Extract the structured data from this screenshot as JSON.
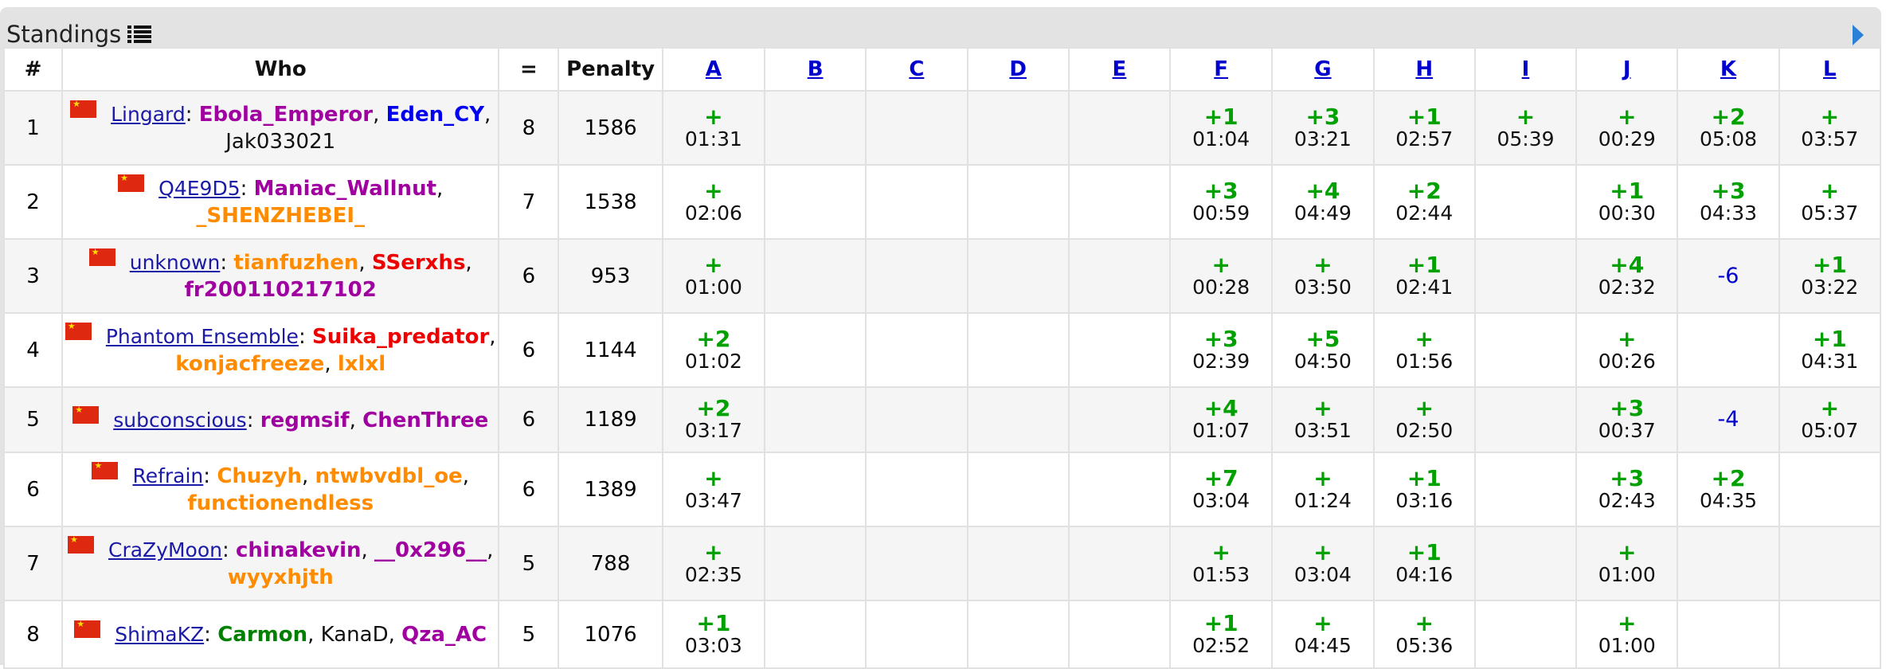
{
  "header": {
    "title": "Standings",
    "list_icon": "list-icon",
    "next_icon": "play-arrow-icon"
  },
  "colors": {
    "accepted": "#00a000",
    "rejected": "#0000cc",
    "team_link": "#1a1aa6",
    "panel": "#e3e3e3",
    "flag": "#de2910"
  },
  "columns": {
    "rank": "#",
    "who": "Who",
    "solved": "=",
    "penalty": "Penalty"
  },
  "problems": [
    "A",
    "B",
    "C",
    "D",
    "E",
    "F",
    "G",
    "H",
    "I",
    "J",
    "K",
    "L"
  ],
  "rows": [
    {
      "rank": "1",
      "team": "Lingard",
      "members": [
        {
          "name": "Ebola_Emperor",
          "color": "purple"
        },
        {
          "name": "Eden_CY",
          "color": "blue"
        },
        {
          "name": "Jak033021",
          "color": "gray"
        }
      ],
      "solved": "8",
      "penalty": "1586",
      "cells": [
        {
          "r": "+",
          "t": "01:31"
        },
        null,
        null,
        null,
        null,
        {
          "r": "+1",
          "t": "01:04"
        },
        {
          "r": "+3",
          "t": "03:21"
        },
        {
          "r": "+1",
          "t": "02:57"
        },
        {
          "r": "+",
          "t": "05:39"
        },
        {
          "r": "+",
          "t": "00:29"
        },
        {
          "r": "+2",
          "t": "05:08"
        },
        {
          "r": "+",
          "t": "03:57"
        }
      ]
    },
    {
      "rank": "2",
      "team": "Q4E9D5",
      "members": [
        {
          "name": "Maniac_Wallnut",
          "color": "purple"
        },
        {
          "name": "_SHENZHEBEI_",
          "color": "orange"
        }
      ],
      "solved": "7",
      "penalty": "1538",
      "cells": [
        {
          "r": "+",
          "t": "02:06"
        },
        null,
        null,
        null,
        null,
        {
          "r": "+3",
          "t": "00:59"
        },
        {
          "r": "+4",
          "t": "04:49"
        },
        {
          "r": "+2",
          "t": "02:44"
        },
        null,
        {
          "r": "+1",
          "t": "00:30"
        },
        {
          "r": "+3",
          "t": "04:33"
        },
        {
          "r": "+",
          "t": "05:37"
        }
      ]
    },
    {
      "rank": "3",
      "team": "unknown",
      "members": [
        {
          "name": "tianfuzhen",
          "color": "orange"
        },
        {
          "name": "SSerxhs",
          "color": "red"
        },
        {
          "name": "fr200110217102",
          "color": "purple"
        }
      ],
      "solved": "6",
      "penalty": "953",
      "cells": [
        {
          "r": "+",
          "t": "01:00"
        },
        null,
        null,
        null,
        null,
        {
          "r": "+",
          "t": "00:28"
        },
        {
          "r": "+",
          "t": "03:50"
        },
        {
          "r": "+1",
          "t": "02:41"
        },
        null,
        {
          "r": "+4",
          "t": "02:32"
        },
        {
          "x": "-6"
        },
        {
          "r": "+1",
          "t": "03:22"
        }
      ]
    },
    {
      "rank": "4",
      "team": "Phantom Ensemble",
      "members": [
        {
          "name": "Suika_predator",
          "color": "red"
        },
        {
          "name": "konjacfreeze",
          "color": "orange"
        },
        {
          "name": "lxlxl",
          "color": "orange"
        }
      ],
      "solved": "6",
      "penalty": "1144",
      "cells": [
        {
          "r": "+2",
          "t": "01:02"
        },
        null,
        null,
        null,
        null,
        {
          "r": "+3",
          "t": "02:39"
        },
        {
          "r": "+5",
          "t": "04:50"
        },
        {
          "r": "+",
          "t": "01:56"
        },
        null,
        {
          "r": "+",
          "t": "00:26"
        },
        null,
        {
          "r": "+1",
          "t": "04:31"
        }
      ]
    },
    {
      "rank": "5",
      "team": "subconscious",
      "members": [
        {
          "name": "regmsif",
          "color": "purple"
        },
        {
          "name": "ChenThree",
          "color": "purple"
        }
      ],
      "solved": "6",
      "penalty": "1189",
      "cells": [
        {
          "r": "+2",
          "t": "03:17"
        },
        null,
        null,
        null,
        null,
        {
          "r": "+4",
          "t": "01:07"
        },
        {
          "r": "+",
          "t": "03:51"
        },
        {
          "r": "+",
          "t": "02:50"
        },
        null,
        {
          "r": "+3",
          "t": "00:37"
        },
        {
          "x": "-4"
        },
        {
          "r": "+",
          "t": "05:07"
        }
      ]
    },
    {
      "rank": "6",
      "team": "Refrain",
      "members": [
        {
          "name": "Chuzyh",
          "color": "orange"
        },
        {
          "name": "ntwbvdbl_oe",
          "color": "orange"
        },
        {
          "name": "functionendless",
          "color": "orange"
        }
      ],
      "solved": "6",
      "penalty": "1389",
      "cells": [
        {
          "r": "+",
          "t": "03:47"
        },
        null,
        null,
        null,
        null,
        {
          "r": "+7",
          "t": "03:04"
        },
        {
          "r": "+",
          "t": "01:24"
        },
        {
          "r": "+1",
          "t": "03:16"
        },
        null,
        {
          "r": "+3",
          "t": "02:43"
        },
        {
          "r": "+2",
          "t": "04:35"
        },
        null
      ]
    },
    {
      "rank": "7",
      "team": "CraZyMoon",
      "members": [
        {
          "name": "chinakevin",
          "color": "purple"
        },
        {
          "name": "__0x296__",
          "color": "purple"
        },
        {
          "name": "wyyxhjth",
          "color": "orange"
        }
      ],
      "solved": "5",
      "penalty": "788",
      "cells": [
        {
          "r": "+",
          "t": "02:35"
        },
        null,
        null,
        null,
        null,
        {
          "r": "+",
          "t": "01:53"
        },
        {
          "r": "+",
          "t": "03:04"
        },
        {
          "r": "+1",
          "t": "04:16"
        },
        null,
        {
          "r": "+",
          "t": "01:00"
        },
        null,
        null
      ]
    },
    {
      "rank": "8",
      "team": "ShimaKZ",
      "members": [
        {
          "name": "Carmon",
          "color": "green"
        },
        {
          "name": "KanaD",
          "color": "gray"
        },
        {
          "name": "Qza_AC",
          "color": "purple"
        }
      ],
      "solved": "5",
      "penalty": "1076",
      "cells": [
        {
          "r": "+1",
          "t": "03:03"
        },
        null,
        null,
        null,
        null,
        {
          "r": "+1",
          "t": "02:52"
        },
        {
          "r": "+",
          "t": "04:45"
        },
        {
          "r": "+",
          "t": "05:36"
        },
        null,
        {
          "r": "+",
          "t": "01:00"
        },
        null,
        null
      ]
    }
  ]
}
